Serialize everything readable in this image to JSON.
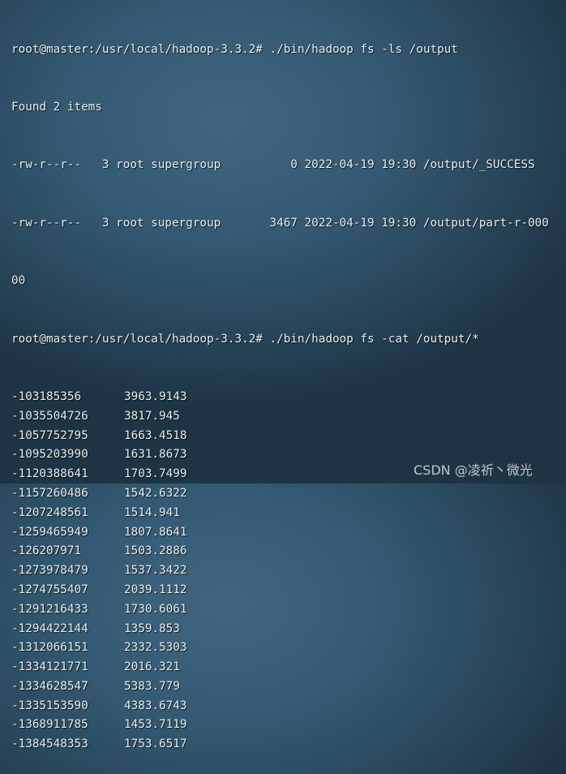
{
  "terminal": {
    "header_lines": [
      "root@master:/usr/local/hadoop-3.3.2# ./bin/hadoop fs -ls /output",
      "Found 2 items",
      "-rw-r--r--   3 root supergroup          0 2022-04-19 19:30 /output/_SUCCESS",
      "-rw-r--r--   3 root supergroup       3467 2022-04-19 19:30 /output/part-r-000",
      "00",
      "root@master:/usr/local/hadoop-3.3.2# ./bin/hadoop fs -cat /output/*"
    ],
    "rows": [
      {
        "key": "-103185356",
        "value": "3963.9143"
      },
      {
        "key": "-1035504726",
        "value": "3817.945"
      },
      {
        "key": "-1057752795",
        "value": "1663.4518"
      },
      {
        "key": "-1095203990",
        "value": "1631.8673"
      },
      {
        "key": "-1120388641",
        "value": "1703.7499"
      },
      {
        "key": "-1157260486",
        "value": "1542.6322"
      },
      {
        "key": "-1207248561",
        "value": "1514.941"
      },
      {
        "key": "-1259465949",
        "value": "1807.8641"
      },
      {
        "key": "-126207971",
        "value": "1503.2886"
      },
      {
        "key": "-1273978479",
        "value": "1537.3422"
      },
      {
        "key": "-1274755407",
        "value": "2039.1112"
      },
      {
        "key": "-1291216433",
        "value": "1730.6061"
      },
      {
        "key": "-1294422144",
        "value": "1359.853"
      },
      {
        "key": "-1312066151",
        "value": "2332.5303"
      },
      {
        "key": "-1334121771",
        "value": "2016.321"
      },
      {
        "key": "-1334628547",
        "value": "5383.779"
      },
      {
        "key": "-1335153590",
        "value": "4383.6743"
      },
      {
        "key": "-1368911785",
        "value": "1453.7119"
      },
      {
        "key": "-1384548353",
        "value": "1753.6517"
      }
    ]
  },
  "watermark": "CSDN @凌祈丶微光"
}
